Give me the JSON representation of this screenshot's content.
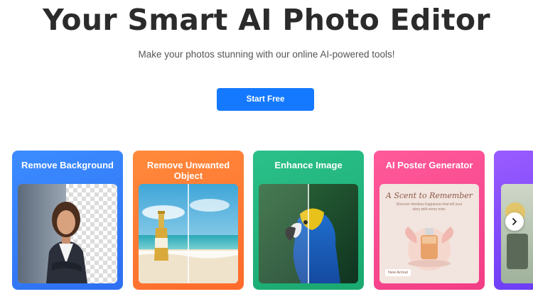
{
  "hero": {
    "title": "Your Smart AI Photo Editor",
    "subtitle": "Make your photos stunning with our online AI-powered tools!",
    "cta_label": "Start Free"
  },
  "cards": [
    {
      "title": "Remove Background"
    },
    {
      "title": "Remove Unwanted Object"
    },
    {
      "title": "Enhance Image"
    },
    {
      "title": "AI Poster Generator"
    }
  ],
  "poster": {
    "headline": "A Scent to Remember",
    "body": "Discover timeless fragrances that tell your story with every note.",
    "badge": "New Arrival"
  },
  "colors": {
    "cta": "#1479ff",
    "card_blue": "#3c8cff",
    "card_orange": "#ff8a3c",
    "card_green": "#2bc08a",
    "card_pink": "#ff5a9a",
    "card_purple": "#9a5cff"
  },
  "icons": {
    "next": "chevron-right-icon"
  }
}
